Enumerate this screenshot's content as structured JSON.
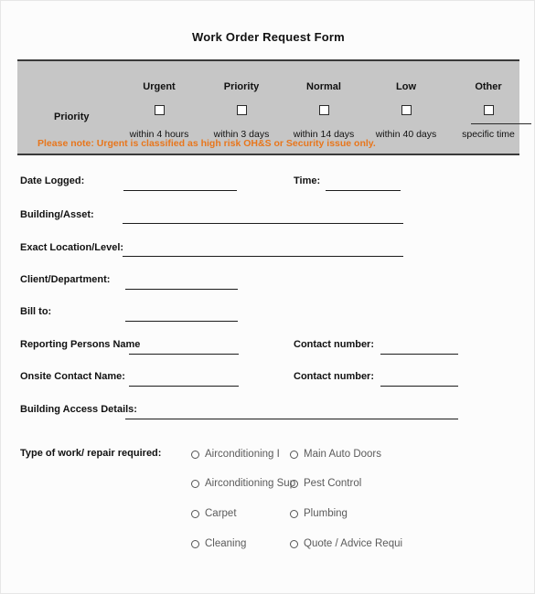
{
  "document": {
    "title": "Work Order Request Form"
  },
  "priority": {
    "row_label": "Priority",
    "note": "Please note: Urgent is classified as high risk OH&S or Security issue only.",
    "note_color": "#e8761c",
    "header_bg": "#c6c6c6",
    "columns": [
      {
        "name": "Urgent",
        "timeframe": "within 4 hours",
        "checked": false
      },
      {
        "name": "Priority",
        "timeframe": "within 3 days",
        "checked": false
      },
      {
        "name": "Normal",
        "timeframe": "within 14 days",
        "checked": false
      },
      {
        "name": "Low",
        "timeframe": "within 40 days",
        "checked": false
      },
      {
        "name": "Other",
        "timeframe": "specific time",
        "checked": false
      }
    ]
  },
  "fields": [
    {
      "label": "Date Logged:",
      "value": ""
    },
    {
      "label": "Time:",
      "value": ""
    },
    {
      "label": "Building/Asset:",
      "value": ""
    },
    {
      "label": "Exact Location/Level:",
      "value": ""
    },
    {
      "label": "Client/Department:",
      "value": ""
    },
    {
      "label": "Bill to:",
      "value": ""
    },
    {
      "label": "Reporting Persons Name",
      "value": ""
    },
    {
      "label": "Contact number:",
      "value": ""
    },
    {
      "label": "Onsite Contact Name:",
      "value": ""
    },
    {
      "label": "Contact number:",
      "value": ""
    },
    {
      "label": "Building Access Details:",
      "value": ""
    }
  ],
  "work_type": {
    "label": "Type of work/ repair required:",
    "options": [
      {
        "label": "Airconditioning I",
        "selected": false
      },
      {
        "label": "Main Auto Doors",
        "selected": false
      },
      {
        "label": "Airconditioning Sup",
        "selected": false
      },
      {
        "label": "Pest Control",
        "selected": false
      },
      {
        "label": "Carpet",
        "selected": false
      },
      {
        "label": "Plumbing",
        "selected": false
      },
      {
        "label": "Cleaning",
        "selected": false
      },
      {
        "label": "Quote / Advice Requi",
        "selected": false
      }
    ]
  }
}
